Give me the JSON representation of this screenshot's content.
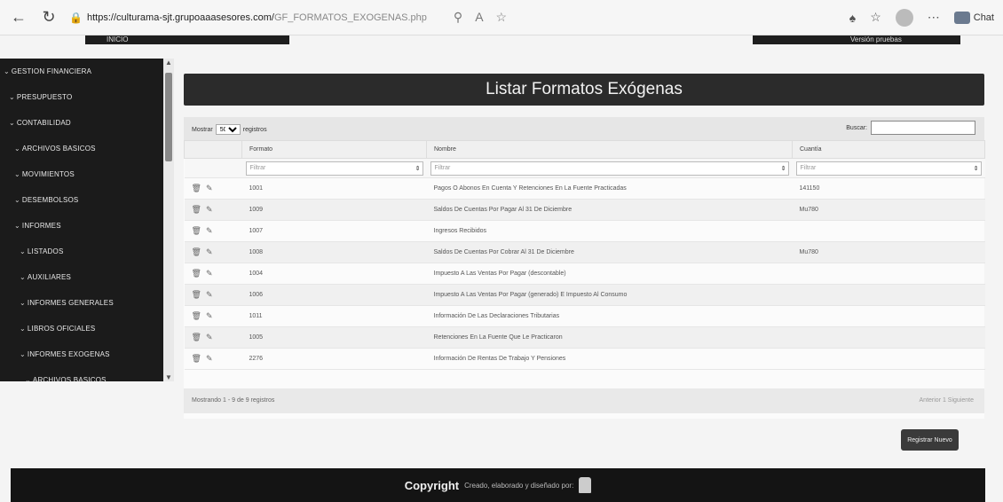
{
  "browser": {
    "url_host": "https://culturama-sjt.grupoaaasesores.com/",
    "url_path": "GF_FORMATOS_EXOGENAS.php",
    "chat_label": "Chat"
  },
  "top_strip": {
    "left_label": "INICIO",
    "right_label": "Versión pruebas"
  },
  "sidebar": {
    "items": [
      {
        "label": "GESTION FINANCIERA",
        "indent": 0
      },
      {
        "label": "PRESUPUESTO",
        "indent": 1
      },
      {
        "label": "CONTABILIDAD",
        "indent": 1
      },
      {
        "label": "ARCHIVOS BASICOS",
        "indent": 2
      },
      {
        "label": "MOVIMIENTOS",
        "indent": 2
      },
      {
        "label": "DESEMBOLSOS",
        "indent": 2
      },
      {
        "label": "INFORMES",
        "indent": 2
      },
      {
        "label": "LISTADOS",
        "indent": 3
      },
      {
        "label": "AUXILIARES",
        "indent": 3
      },
      {
        "label": "INFORMES GENERALES",
        "indent": 3
      },
      {
        "label": "LIBROS OFICIALES",
        "indent": 3
      },
      {
        "label": "INFORMES EXOGENAS",
        "indent": 3
      },
      {
        "label": "ARCHIVOS BASICOS",
        "indent": 4
      }
    ]
  },
  "page_title": "Listar Formatos Exógenas",
  "controls": {
    "show_label": "Mostrar",
    "show_value": "50",
    "records_label": "registros",
    "search_label": "Buscar:"
  },
  "table": {
    "headers": [
      "",
      "Formato",
      "Nombre",
      "Cuantía"
    ],
    "filter_placeholders": [
      "Filtrar",
      "Filtrar",
      "Filtrar"
    ],
    "rows": [
      {
        "formato": "1001",
        "nombre": "Pagos O Abonos En Cuenta Y Retenciones En La Fuente Practicadas",
        "cuantia": "141150"
      },
      {
        "formato": "1009",
        "nombre": "Saldos De Cuentas Por Pagar Al 31 De Diciembre",
        "cuantia": "Mu780"
      },
      {
        "formato": "1007",
        "nombre": "Ingresos Recibidos",
        "cuantia": ""
      },
      {
        "formato": "1008",
        "nombre": "Saldos De Cuentas Por Cobrar Al 31 De Diciembre",
        "cuantia": "Mu780"
      },
      {
        "formato": "1004",
        "nombre": "Impuesto A Las Ventas Por Pagar (descontable)",
        "cuantia": ""
      },
      {
        "formato": "1006",
        "nombre": "Impuesto A Las Ventas Por Pagar (generado) E Impuesto Al Consumo",
        "cuantia": ""
      },
      {
        "formato": "1011",
        "nombre": "Información De Las Declaraciones Tributarias",
        "cuantia": ""
      },
      {
        "formato": "1005",
        "nombre": "Retenciones En La Fuente Que Le Practicaron",
        "cuantia": ""
      },
      {
        "formato": "2276",
        "nombre": "Información De Rentas De Trabajo Y Pensiones",
        "cuantia": ""
      }
    ]
  },
  "footer_info": {
    "info": "Mostrando 1 - 9 de 9 registros",
    "pager": "Anterior 1 Siguiente"
  },
  "register_button": "Registrar Nuevo",
  "copyright": {
    "label": "Copyright",
    "text": "Creado, elaborado y diseñado por:"
  }
}
